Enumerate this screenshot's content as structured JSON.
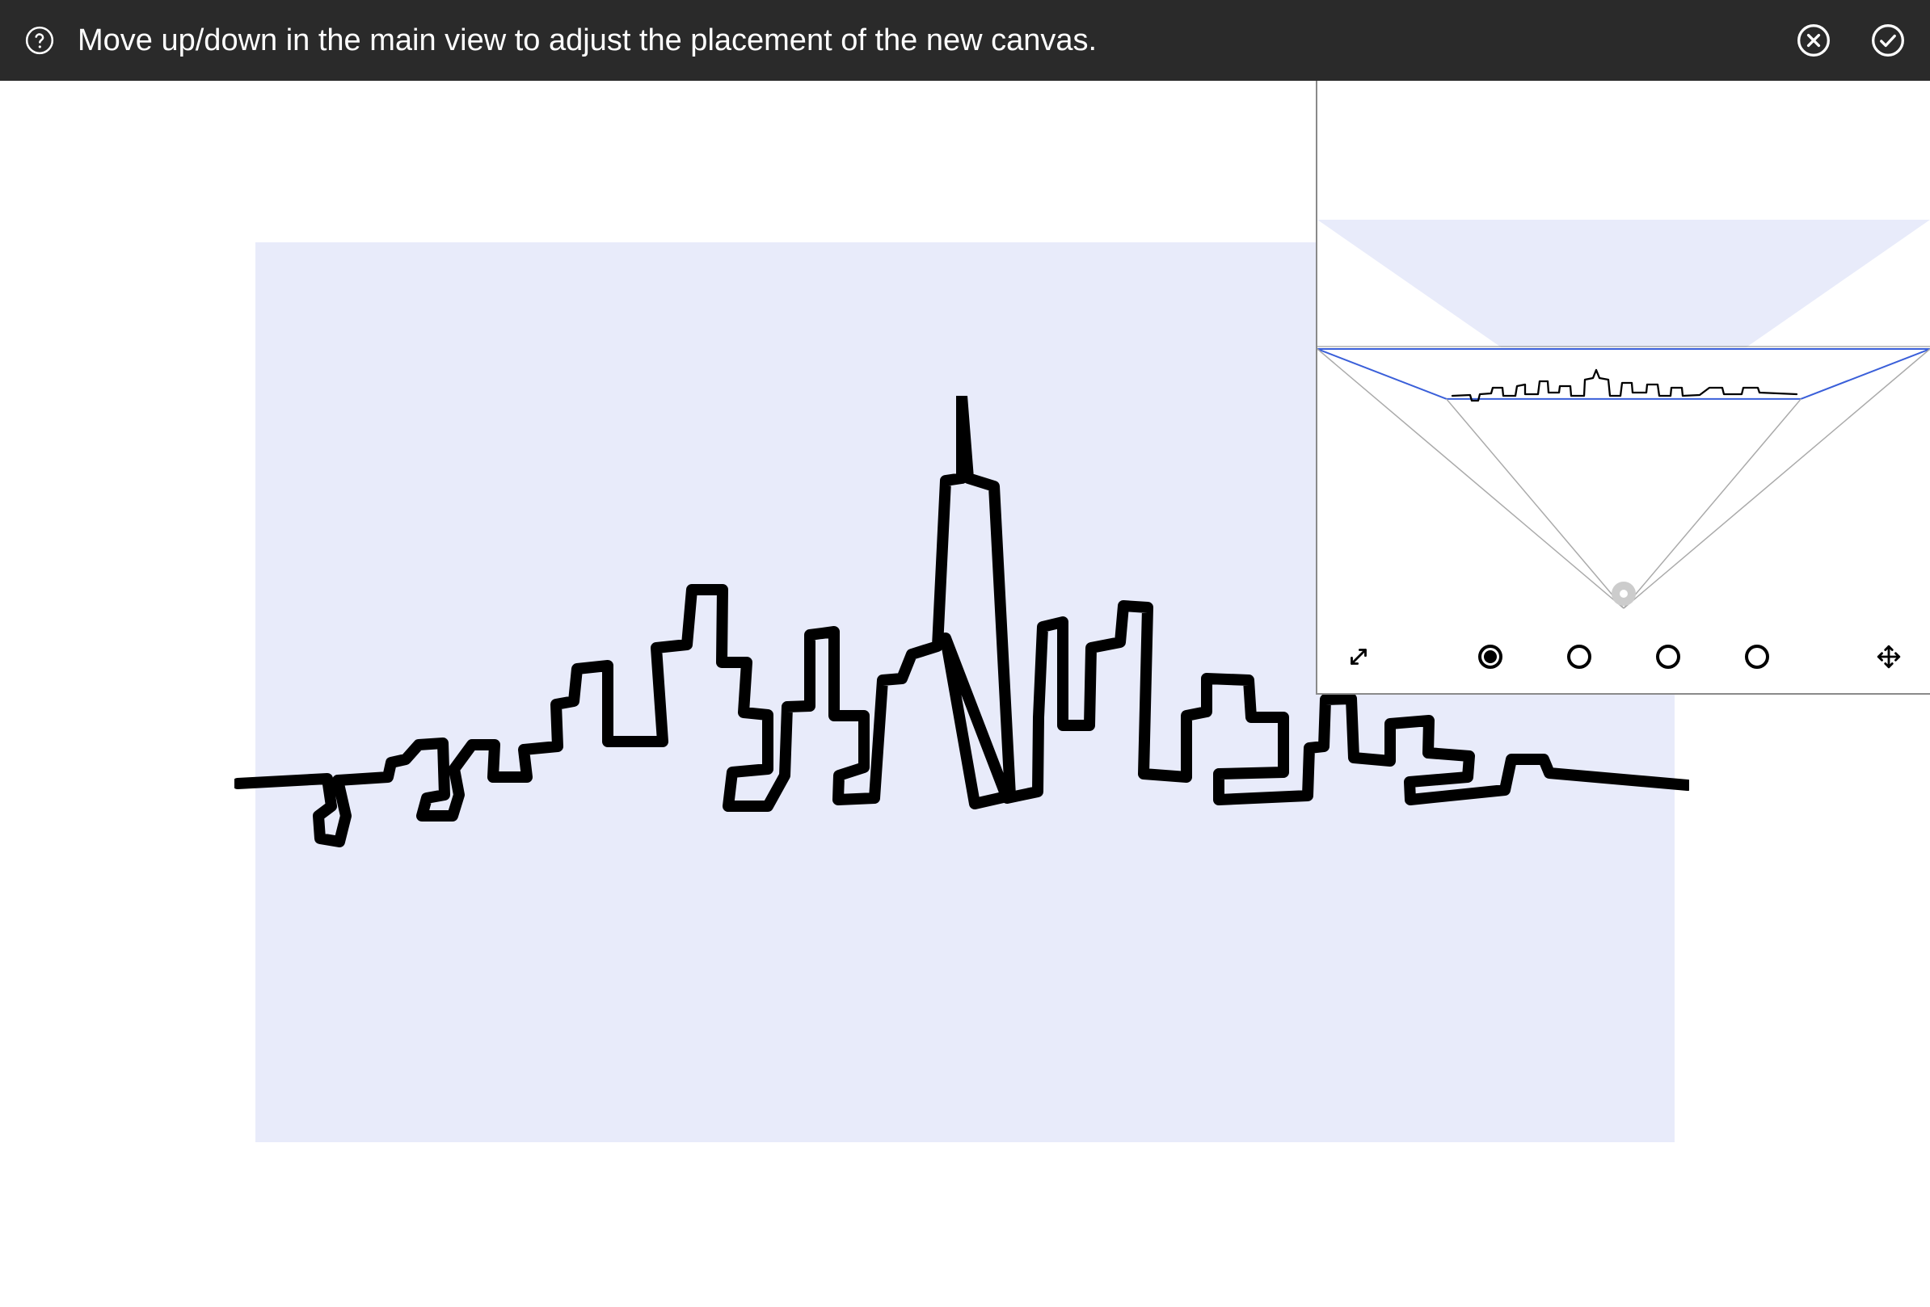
{
  "topbar": {
    "instruction": "Move up/down in the main view to adjust the placement of the new canvas."
  },
  "panel": {
    "view_options": [
      {
        "selected": true
      },
      {
        "selected": false
      },
      {
        "selected": false
      },
      {
        "selected": false
      }
    ]
  }
}
